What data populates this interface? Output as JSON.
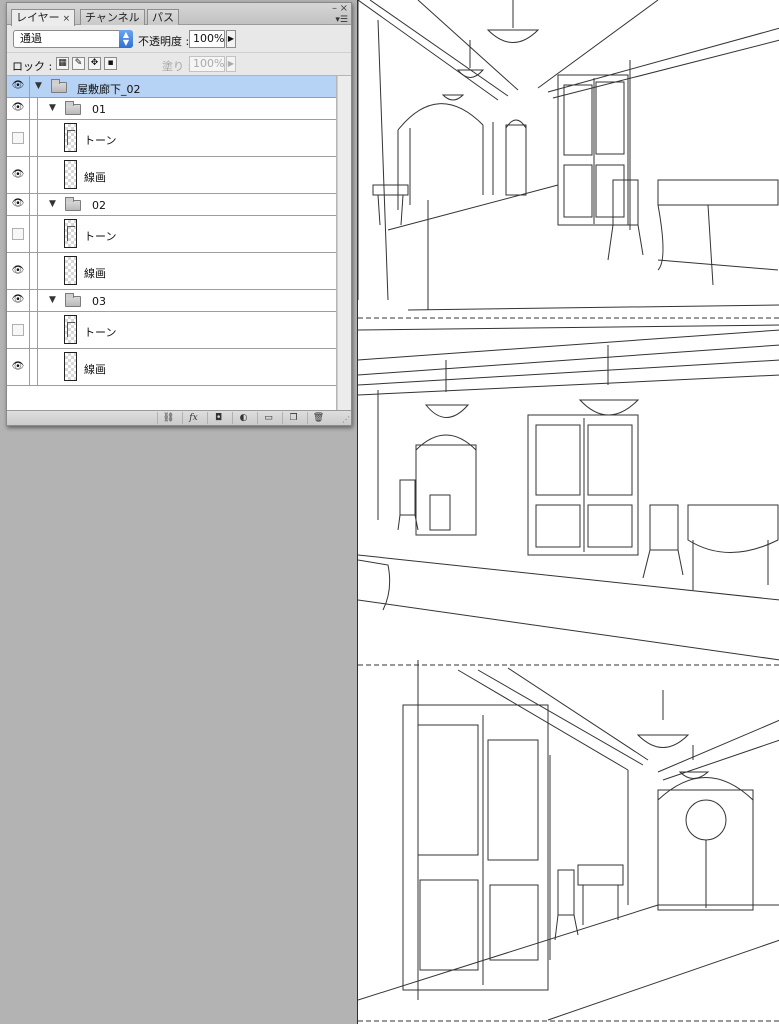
{
  "panel": {
    "tabs": [
      {
        "label": "レイヤー",
        "active": true
      },
      {
        "label": "チャンネル",
        "active": false
      },
      {
        "label": "パス",
        "active": false
      }
    ],
    "window_controls": {
      "minimize": "–",
      "close": "×"
    },
    "close_tab": "×",
    "menu_icon": "panel-menu-icon",
    "blend_mode": "通過",
    "opacity_label": "不透明度 :",
    "opacity_value": "100%",
    "lock_label": "ロック :",
    "fill_label": "塗り :",
    "fill_value": "100%",
    "layers": [
      {
        "type": "group",
        "name": "屋敷廊下_02",
        "visible": true,
        "expanded": true,
        "selected": true,
        "depth": 0
      },
      {
        "type": "group",
        "name": "01",
        "visible": true,
        "expanded": true,
        "depth": 1
      },
      {
        "type": "layer",
        "name": "トーン",
        "visible": false,
        "depth": 2,
        "thumb": "tone"
      },
      {
        "type": "layer",
        "name": "線画",
        "visible": true,
        "depth": 2,
        "thumb": "line"
      },
      {
        "type": "group",
        "name": "02",
        "visible": true,
        "expanded": true,
        "depth": 1
      },
      {
        "type": "layer",
        "name": "トーン",
        "visible": false,
        "depth": 2,
        "thumb": "tone"
      },
      {
        "type": "layer",
        "name": "線画",
        "visible": true,
        "depth": 2,
        "thumb": "line"
      },
      {
        "type": "group",
        "name": "03",
        "visible": true,
        "expanded": true,
        "depth": 1
      },
      {
        "type": "layer",
        "name": "トーン",
        "visible": false,
        "depth": 2,
        "thumb": "tone"
      },
      {
        "type": "layer",
        "name": "線画",
        "visible": true,
        "depth": 2,
        "thumb": "line"
      }
    ],
    "bottom_buttons": [
      "link-layers-icon",
      "fx-icon",
      "layer-mask-icon",
      "adjustment-layer-icon",
      "new-group-icon",
      "new-layer-icon",
      "trash-icon"
    ],
    "bottom_glyphs": {
      "link": "⛓",
      "fx": "fx",
      "mask": "◘",
      "adjust": "◐",
      "group": "▭",
      "new": "❐",
      "trash": "🗑"
    }
  },
  "canvas": {
    "panels": [
      "hallway-scene-1",
      "hallway-scene-2",
      "hallway-scene-3"
    ],
    "colors": {
      "ink": "#333333",
      "paper": "#ffffff",
      "desktop": "#b3b3b3",
      "selection": "#b6d3f5"
    }
  }
}
